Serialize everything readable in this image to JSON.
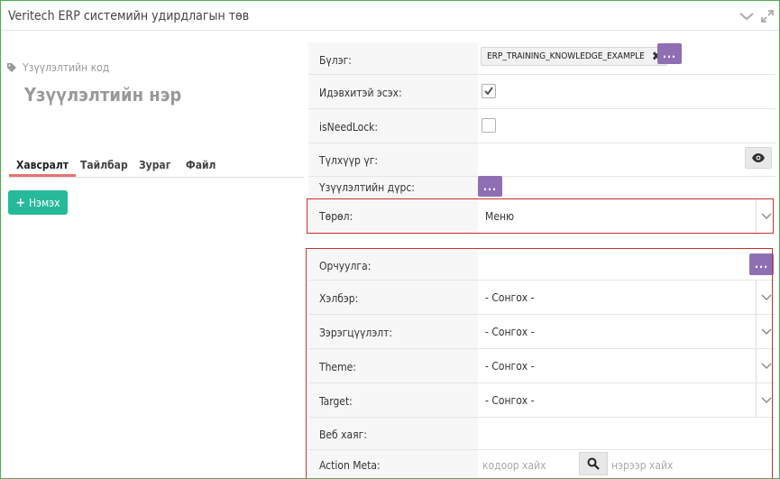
{
  "window": {
    "title": "Veritech ERP системийн удирдлагын төв",
    "icons": [
      "chevron-down-icon",
      "expand-icon"
    ]
  },
  "left": {
    "code_label": "Үзүүлэлтийн код",
    "name_label": "Үзүүлэлтийн нэр",
    "tabs": [
      "Хавсралт",
      "Тайлбар",
      "Зураг",
      "Файл"
    ],
    "active_tab": "Хавсралт",
    "add_button": "Нэмэх"
  },
  "form": {
    "group_label": "Бүлэг:",
    "group_value": "ERP_TRAINING_KNOWLEDGE_EXAMPLE",
    "active_label": "Идэвхитэй эсэх:",
    "active_checked": true,
    "needlock_label": "isNeedLock:",
    "needlock_checked": false,
    "key_label": "Түлхүүр үг:",
    "indicator_type_label": "Үзүүлэлтийн дүрс:",
    "type_label": "Төрөл:",
    "type_value": "Меню",
    "dots": "...",
    "translation_label": "Орчуулга:",
    "form_label": "Хэлбэр:",
    "icon_label": "Зэрэгцүүлэлт:",
    "theme_label": "Theme:",
    "target_label": "Target:",
    "select_placeholder": "- Сонгох -",
    "url_label": "Веб хаяг:",
    "action_meta_label": "Action Meta:",
    "code_search_placeholder": "кодоор хайх",
    "name_search_placeholder": "нэрээр хайх"
  },
  "colors": {
    "accent_green": "#26b99a",
    "purple_button": "#8e6fb3",
    "highlight_red": "#c9302c",
    "tab_underline": "#e57373",
    "frame_green": "#4caf50"
  }
}
